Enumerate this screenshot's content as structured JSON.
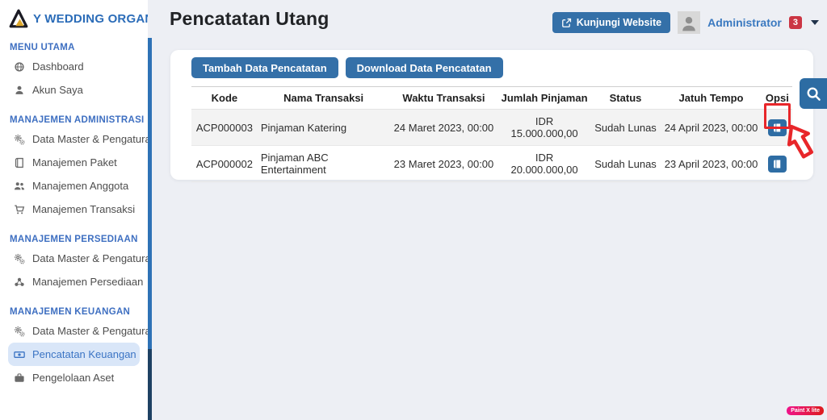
{
  "brand": {
    "name": "Y WEDDING ORGANIZER"
  },
  "sidebar": {
    "sections": [
      {
        "title": "MENU UTAMA",
        "items": [
          {
            "label": "Dashboard"
          },
          {
            "label": "Akun Saya"
          }
        ]
      },
      {
        "title": "MANAJEMEN ADMINISTRASI",
        "items": [
          {
            "label": "Data Master & Pengaturan"
          },
          {
            "label": "Manajemen Paket"
          },
          {
            "label": "Manajemen Anggota"
          },
          {
            "label": "Manajemen Transaksi"
          }
        ]
      },
      {
        "title": "MANAJEMEN PERSEDIAAN",
        "items": [
          {
            "label": "Data Master & Pengaturan"
          },
          {
            "label": "Manajemen Persediaan"
          }
        ]
      },
      {
        "title": "MANAJEMEN KEUANGAN",
        "items": [
          {
            "label": "Data Master & Pengaturan"
          },
          {
            "label": "Pencatatan Keuangan"
          },
          {
            "label": "Pengelolaan Aset"
          }
        ]
      }
    ]
  },
  "header": {
    "page_title": "Pencatatan Utang",
    "visit_website_label": "Kunjungi Website",
    "user_name": "Administrator",
    "notification_count": "3"
  },
  "toolbar": {
    "add_label": "Tambah Data Pencatatan",
    "download_label": "Download Data Pencatatan"
  },
  "table": {
    "columns": [
      "Kode",
      "Nama Transaksi",
      "Waktu Transaksi",
      "Jumlah Pinjaman",
      "Status",
      "Jatuh Tempo",
      "Opsi"
    ],
    "rows": [
      {
        "kode": "ACP000003",
        "nama": "Pinjaman Katering",
        "waktu": "24 Maret 2023, 00:00",
        "jumlah": "IDR 15.000.000,00",
        "status": "Sudah Lunas",
        "jatuh_tempo": "24 April 2023, 00:00"
      },
      {
        "kode": "ACP000002",
        "nama": "Pinjaman ABC Entertainment",
        "waktu": "23 Maret 2023, 00:00",
        "jumlah": "IDR 20.000.000,00",
        "status": "Sudah Lunas",
        "jatuh_tempo": "23 April 2023, 00:00"
      }
    ]
  },
  "watermark": "Paint X lite",
  "colors": {
    "accent": "#3470a8",
    "accent_dark": "#2e6da4",
    "badge_red": "#cb3543",
    "annotation_red": "#e8262a",
    "active_item_bg": "#d9e6f8",
    "section_title_blue": "#3e6fc1"
  }
}
